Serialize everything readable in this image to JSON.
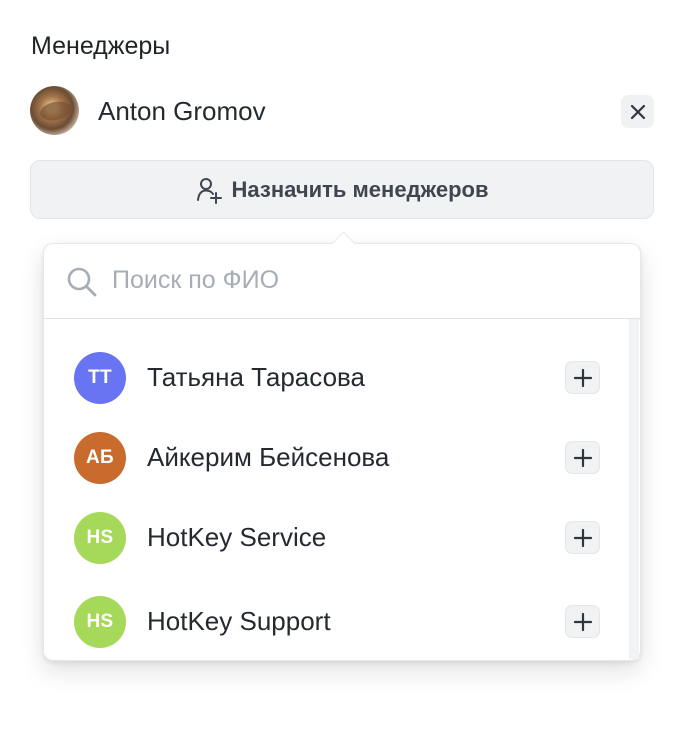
{
  "section": {
    "title": "Менеджеры"
  },
  "assigned_managers": [
    {
      "name": "Anton Gromov",
      "avatar_icon": "profile-photo-avatar",
      "remove_icon": "close-icon"
    }
  ],
  "assign_button": {
    "label": "Назначить менеджеров",
    "icon": "add-user-icon"
  },
  "search": {
    "placeholder": "Поиск по ФИО",
    "value": "",
    "icon": "search-icon"
  },
  "people_list": [
    {
      "initials": "TT",
      "name": "Татьяна Тарасова",
      "avatar_color": "#6874F2",
      "action_icon": "plus-icon"
    },
    {
      "initials": "АБ",
      "name": "Айкерим Бейсенова",
      "avatar_color": "#C96B2D",
      "action_icon": "plus-icon"
    },
    {
      "initials": "HS",
      "name": "HotKey Service",
      "avatar_color": "#A6D85A",
      "action_icon": "plus-icon"
    },
    {
      "initials": "HS",
      "name": "HotKey Support",
      "avatar_color": "#A6D85A",
      "action_icon": "plus-icon"
    }
  ],
  "theme": {
    "text": "#1F2329",
    "muted_text": "#A7ADB5",
    "button_background": "#F1F2F4",
    "border": "#E5E7EB"
  }
}
